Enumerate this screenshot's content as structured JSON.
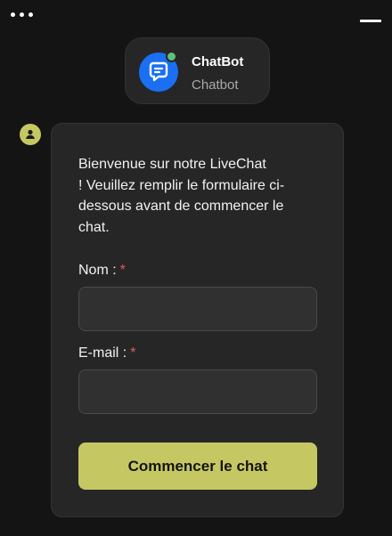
{
  "header": {
    "menu_icon": "more-horizontal-icon",
    "minimize_icon": "minimize-icon"
  },
  "agent": {
    "name": "ChatBot",
    "role": "Chatbot",
    "avatar_icon": "chat-bubble-icon",
    "status": "online",
    "avatar_color": "#1a6ff2",
    "status_color": "#5ec07a"
  },
  "message": {
    "sender_icon": "user-icon",
    "intro_lines": [
      "Bienvenue sur notre LiveChat",
      "! Veuillez remplir le formulaire ci-",
      "dessous avant de commencer le",
      "chat."
    ],
    "form": {
      "name_label": "Nom :",
      "name_value": "",
      "email_label": "E-mail :",
      "email_value": "",
      "required_mark": "*",
      "submit_label": "Commencer le chat"
    }
  },
  "colors": {
    "background": "#141414",
    "card": "#262626",
    "accent": "#c5c862",
    "required": "#e05a5a"
  }
}
